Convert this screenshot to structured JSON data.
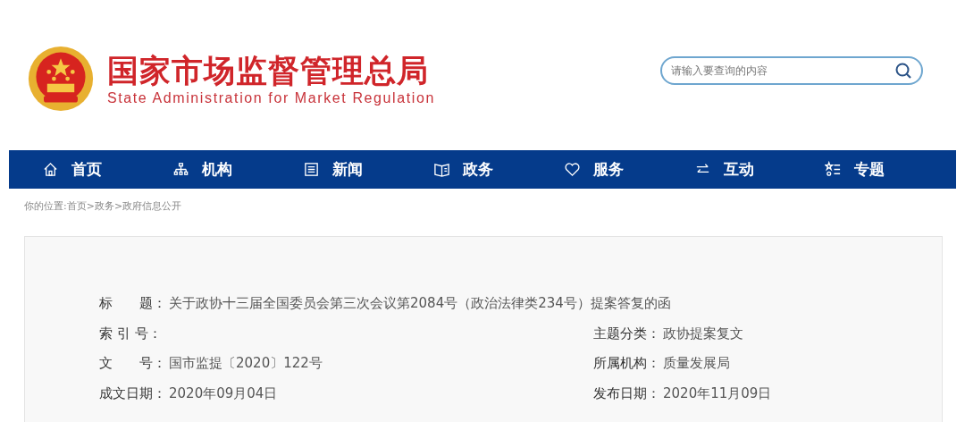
{
  "header": {
    "title": "国家市场监督管理总局",
    "subtitle": "State Administration for Market Regulation",
    "search": {
      "placeholder": "请输入要查询的内容"
    }
  },
  "nav": [
    {
      "kind": "home",
      "label": "首页"
    },
    {
      "kind": "org",
      "label": "机构"
    },
    {
      "kind": "news",
      "label": "新闻"
    },
    {
      "kind": "gov",
      "label": "政务"
    },
    {
      "kind": "heart",
      "label": "服务"
    },
    {
      "kind": "swap",
      "label": "互动"
    },
    {
      "kind": "list",
      "label": "专题"
    }
  ],
  "breadcrumb": "你的位置:首页>政务>政府信息公开",
  "info": {
    "title_row": {
      "label": "标　　题：",
      "value": "关于政协十三届全国委员会第三次会议第2084号（政治法律类234号）提案答复的函"
    },
    "rows": [
      {
        "label": "索 引 号："
      },
      {
        "label": "主题分类：",
        "value": "政协提案复文"
      },
      {
        "label": "文　　号：",
        "value": "国市监提〔2020〕122号"
      },
      {
        "label": "所属机构：",
        "value": "质量发展局"
      },
      {
        "label": "成文日期：",
        "value": "2020年09月04日"
      },
      {
        "label": "发布日期：",
        "value": "2020年11月09日"
      }
    ]
  }
}
